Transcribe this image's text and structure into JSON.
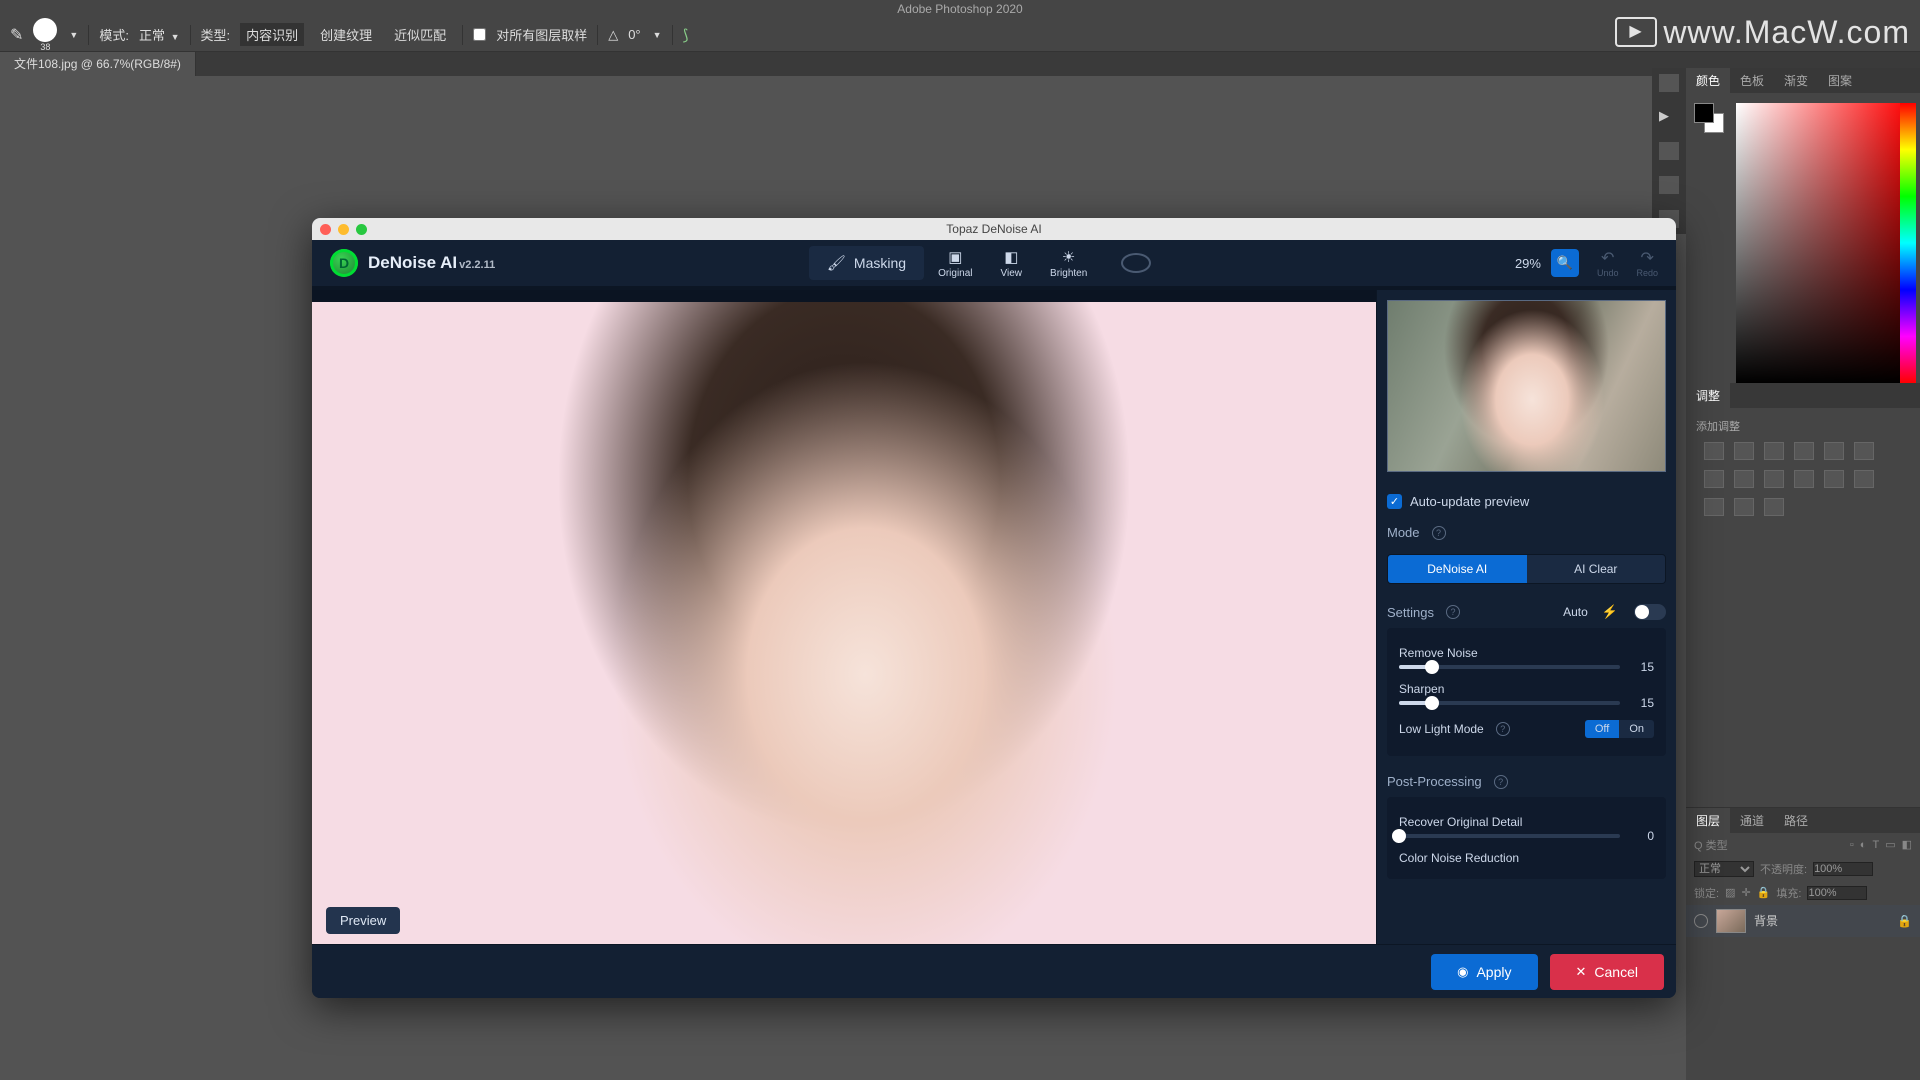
{
  "ps": {
    "title": "Adobe Photoshop 2020",
    "brush_size": "38",
    "mode_label": "模式:",
    "mode_value": "正常",
    "type_label": "类型:",
    "type_opts": [
      "内容识别",
      "创建纹理",
      "近似匹配"
    ],
    "sample_all": "对所有图层取样",
    "angle_icon": "△",
    "angle_value": "0°",
    "doc_tab": "文件108.jpg @ 66.7%(RGB/8#)",
    "panels": {
      "color": "颜色",
      "swatches": "色板",
      "grad": "渐变",
      "pattern": "图案",
      "adjust": "调整",
      "add_adjust": "添加调整",
      "layers": "图层",
      "channels": "通道",
      "paths": "路径"
    },
    "layer_type": "Q 类型",
    "blend": "正常",
    "opacity_label": "不透明度:",
    "opacity": "100%",
    "lock_label": "锁定:",
    "fill_label": "填充:",
    "fill": "100%",
    "layer_bg": "背景"
  },
  "watermark": "www.MacW.com",
  "tp": {
    "window_title": "Topaz DeNoise AI",
    "app": "DeNoise AI",
    "ver": "v2.2.11",
    "masking": "Masking",
    "hbtns": {
      "original": "Original",
      "view": "View",
      "brighten": "Brighten"
    },
    "zoom": "29%",
    "undo": "Undo",
    "redo": "Redo",
    "preview": "Preview",
    "auto_update": "Auto-update preview",
    "mode": "Mode",
    "mode_opts": {
      "denoise": "DeNoise AI",
      "aiclear": "AI Clear"
    },
    "settings": "Settings",
    "auto": "Auto",
    "remove_noise": "Remove Noise",
    "remove_noise_val": "15",
    "sharpen": "Sharpen",
    "sharpen_val": "15",
    "lowlight": "Low Light Mode",
    "off": "Off",
    "on": "On",
    "postproc": "Post-Processing",
    "recover": "Recover Original Detail",
    "recover_val": "0",
    "colornoise": "Color Noise Reduction",
    "apply": "Apply",
    "cancel": "Cancel"
  }
}
